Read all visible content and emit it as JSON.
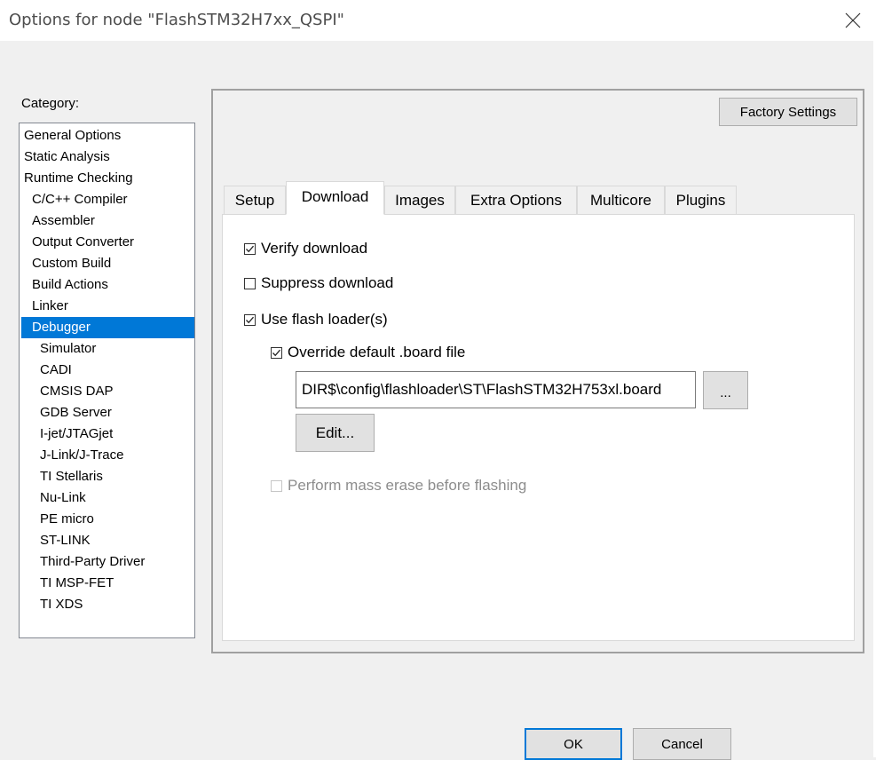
{
  "window": {
    "title": "Options for node \"FlashSTM32H7xx_QSPI\""
  },
  "category": {
    "label": "Category:",
    "items": [
      {
        "label": "General Options",
        "indent": 0
      },
      {
        "label": "Static Analysis",
        "indent": 0
      },
      {
        "label": "Runtime Checking",
        "indent": 0
      },
      {
        "label": "C/C++ Compiler",
        "indent": 1
      },
      {
        "label": "Assembler",
        "indent": 1
      },
      {
        "label": "Output Converter",
        "indent": 1
      },
      {
        "label": "Custom Build",
        "indent": 1
      },
      {
        "label": "Build Actions",
        "indent": 1
      },
      {
        "label": "Linker",
        "indent": 1
      },
      {
        "label": "Debugger",
        "indent": 1,
        "selected": true
      },
      {
        "label": "Simulator",
        "indent": 2
      },
      {
        "label": "CADI",
        "indent": 2
      },
      {
        "label": "CMSIS DAP",
        "indent": 2
      },
      {
        "label": "GDB Server",
        "indent": 2
      },
      {
        "label": "I-jet/JTAGjet",
        "indent": 2
      },
      {
        "label": "J-Link/J-Trace",
        "indent": 2
      },
      {
        "label": "TI Stellaris",
        "indent": 2
      },
      {
        "label": "Nu-Link",
        "indent": 2
      },
      {
        "label": "PE micro",
        "indent": 2
      },
      {
        "label": "ST-LINK",
        "indent": 2
      },
      {
        "label": "Third-Party Driver",
        "indent": 2
      },
      {
        "label": "TI MSP-FET",
        "indent": 2
      },
      {
        "label": "TI XDS",
        "indent": 2
      }
    ]
  },
  "panel": {
    "factory_settings_label": "Factory Settings",
    "tabs": [
      {
        "label": "Setup"
      },
      {
        "label": "Download",
        "active": true
      },
      {
        "label": "Images"
      },
      {
        "label": "Extra Options"
      },
      {
        "label": "Multicore"
      },
      {
        "label": "Plugins"
      }
    ],
    "download": {
      "verify": {
        "label": "Verify download",
        "checked": true
      },
      "suppress": {
        "label": "Suppress download",
        "checked": false
      },
      "use_flash_loader": {
        "label": "Use flash loader(s)",
        "checked": true
      },
      "override_board": {
        "label": "Override default .board file",
        "checked": true
      },
      "board_path": "DIR$\\config\\flashloader\\ST\\FlashSTM32H753xl.board",
      "browse_label": "...",
      "edit_label": "Edit...",
      "mass_erase": {
        "label": "Perform mass erase before flashing",
        "checked": false,
        "disabled": true
      }
    }
  },
  "footer": {
    "ok_label": "OK",
    "cancel_label": "Cancel"
  },
  "colors": {
    "selection": "#0078d7",
    "focus_border": "#0078d7"
  }
}
